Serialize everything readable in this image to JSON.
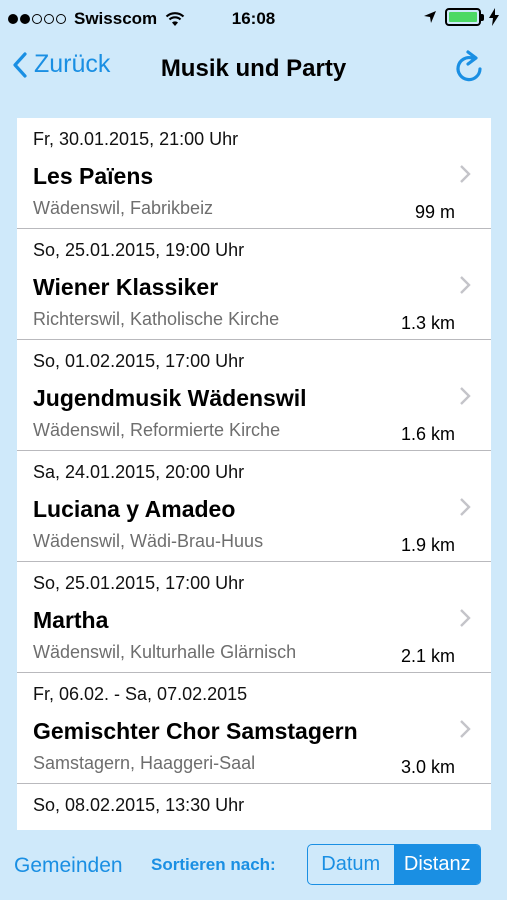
{
  "status_bar": {
    "carrier": "Swisscom",
    "time": "16:08",
    "signal_bars_filled": 2,
    "signal_bars_total": 5,
    "battery_color": "#4cd964"
  },
  "nav": {
    "back_label": "Zurück",
    "title": "Musik und Party",
    "refresh_icon": "refresh-icon"
  },
  "events": [
    {
      "date": "Fr, 30.01.2015, 21:00 Uhr",
      "title": "Les Païens",
      "venue": "Wädenswil, Fabrikbeiz",
      "distance": "99 m"
    },
    {
      "date": "So, 25.01.2015, 19:00 Uhr",
      "title": "Wiener Klassiker",
      "venue": "Richterswil, Katholische Kirche",
      "distance": "1.3 km"
    },
    {
      "date": "So, 01.02.2015, 17:00 Uhr",
      "title": "Jugendmusik Wädenswil",
      "venue": "Wädenswil, Reformierte Kirche",
      "distance": "1.6 km"
    },
    {
      "date": "Sa, 24.01.2015, 20:00 Uhr",
      "title": "Luciana y Amadeo",
      "venue": "Wädenswil, Wädi-Brau-Huus",
      "distance": "1.9 km"
    },
    {
      "date": "So, 25.01.2015, 17:00 Uhr",
      "title": "Martha",
      "venue": "Wädenswil, Kulturhalle Glärnisch",
      "distance": "2.1 km"
    },
    {
      "date": "Fr, 06.02. - Sa, 07.02.2015",
      "title": "Gemischter Chor Samstagern",
      "venue": "Samstagern, Haaggeri-Saal",
      "distance": "3.0 km"
    },
    {
      "date": "So, 08.02.2015, 13:30 Uhr",
      "title": "",
      "venue": "",
      "distance": ""
    }
  ],
  "toolbar": {
    "gemeinden_label": "Gemeinden",
    "sort_label": "Sortieren nach:",
    "sort_options": [
      "Datum",
      "Distanz"
    ],
    "sort_selected": "Distanz"
  },
  "colors": {
    "accent": "#1a8fe3",
    "background": "#cfe9fa"
  }
}
